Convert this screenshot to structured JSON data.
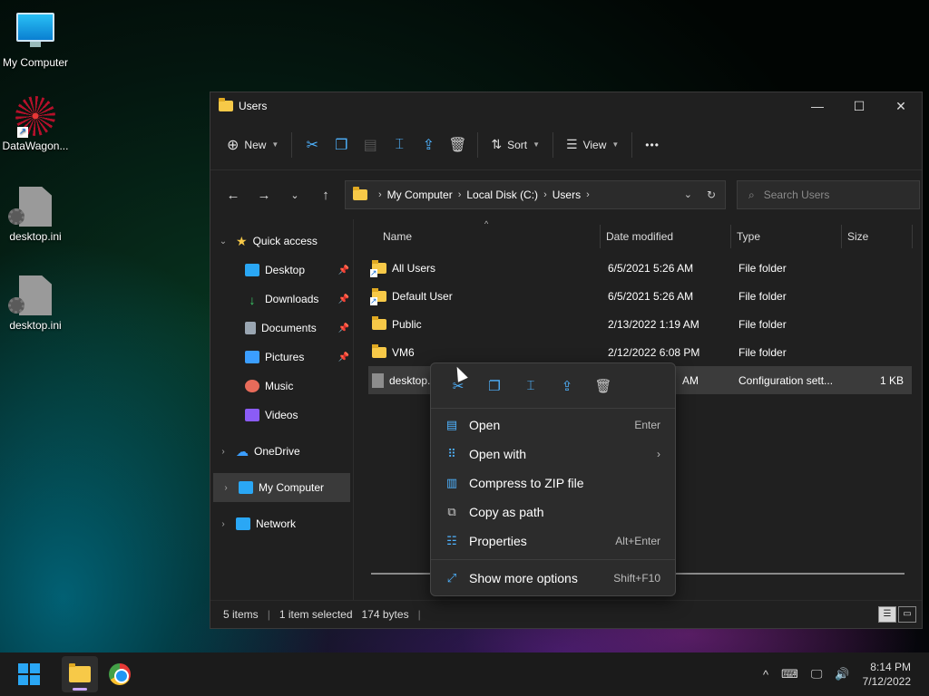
{
  "desktop": {
    "icons": [
      {
        "label": "My Computer",
        "icon": "monitor-icon"
      },
      {
        "label": "DataWagon...",
        "icon": "datawagon-icon"
      },
      {
        "label": "desktop.ini",
        "icon": "ini-file-icon"
      },
      {
        "label": "desktop.ini",
        "icon": "ini-file-icon"
      }
    ]
  },
  "window": {
    "title": "Users",
    "controls": {
      "minimize": "—",
      "maximize": "☐",
      "close": "✕"
    }
  },
  "toolbar": {
    "new_label": "New",
    "sort_label": "Sort",
    "view_label": "View",
    "more_label": "•••"
  },
  "address": {
    "crumbs": [
      "My Computer",
      "Local Disk (C:)",
      "Users"
    ],
    "search_placeholder": "Search Users"
  },
  "sidebar": {
    "quick_access": "Quick access",
    "items": [
      {
        "label": "Desktop",
        "color": "#2aa7f5",
        "pinned": true
      },
      {
        "label": "Downloads",
        "color": "#3ccf6a",
        "pinned": true
      },
      {
        "label": "Documents",
        "color": "#9aa6b2",
        "pinned": true
      },
      {
        "label": "Pictures",
        "color": "#3b9eff",
        "pinned": true
      },
      {
        "label": "Music",
        "color": "#e86b5a",
        "pinned": false
      },
      {
        "label": "Videos",
        "color": "#8b5cf6",
        "pinned": false
      }
    ],
    "onedrive": "OneDrive",
    "my_computer": "My Computer",
    "network": "Network"
  },
  "columns": {
    "name": "Name",
    "date": "Date modified",
    "type": "Type",
    "size": "Size"
  },
  "files": [
    {
      "name": "All Users",
      "date": "6/5/2021 5:26 AM",
      "type": "File folder",
      "size": ""
    },
    {
      "name": "Default User",
      "date": "6/5/2021 5:26 AM",
      "type": "File folder",
      "size": ""
    },
    {
      "name": "Public",
      "date": "2/13/2022 1:19 AM",
      "type": "File folder",
      "size": ""
    },
    {
      "name": "VM6",
      "date": "2/12/2022 6:08 PM",
      "type": "File folder",
      "size": ""
    },
    {
      "name": "desktop.",
      "date": "AM",
      "type": "Configuration sett...",
      "size": "1 KB"
    }
  ],
  "status": {
    "items": "5 items",
    "selected": "1 item selected",
    "bytes": "174 bytes"
  },
  "context_menu": {
    "items": [
      {
        "label": "Open",
        "key": "Enter",
        "icon": "open-icon"
      },
      {
        "label": "Open with",
        "key": "",
        "icon": "open-with-icon"
      },
      {
        "label": "Compress to ZIP file",
        "key": "",
        "icon": "zip-icon"
      },
      {
        "label": "Copy as path",
        "key": "",
        "icon": "copy-path-icon"
      },
      {
        "label": "Properties",
        "key": "Alt+Enter",
        "icon": "properties-icon"
      },
      {
        "label": "Show more options",
        "key": "Shift+F10",
        "icon": "more-options-icon"
      }
    ]
  },
  "taskbar": {
    "time": "8:14 PM",
    "date": "7/12/2022"
  },
  "accent": "#4fb3ff"
}
